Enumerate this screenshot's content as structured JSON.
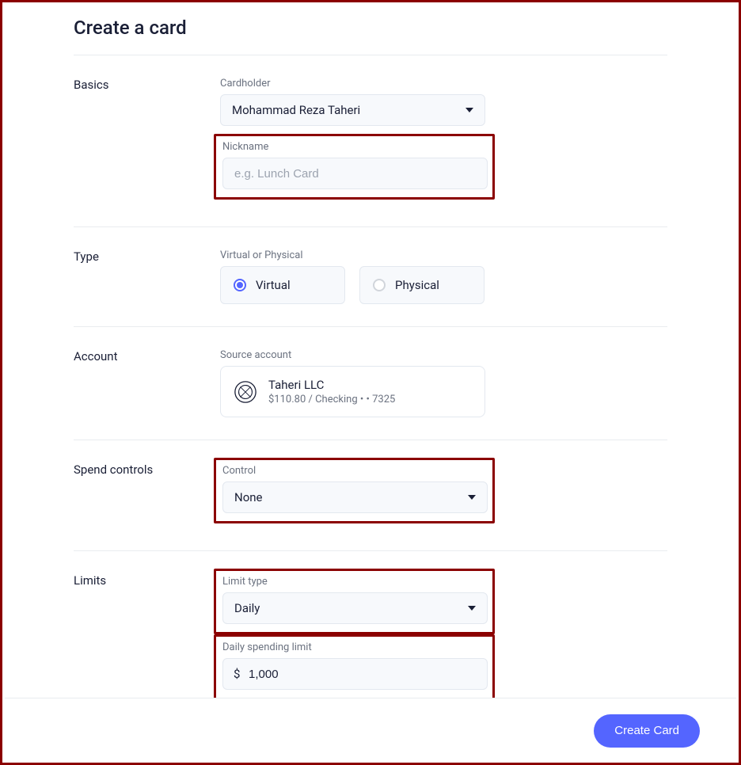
{
  "title": "Create a card",
  "sections": {
    "basics": {
      "label": "Basics",
      "cardholder": {
        "label": "Cardholder",
        "value": "Mohammad Reza Taheri"
      },
      "nickname": {
        "label": "Nickname",
        "placeholder": "e.g. Lunch Card",
        "value": ""
      }
    },
    "type": {
      "label": "Type",
      "group_label": "Virtual or Physical",
      "options": {
        "virtual": "Virtual",
        "physical": "Physical"
      },
      "selected": "virtual"
    },
    "account": {
      "label": "Account",
      "field_label": "Source account",
      "name": "Taheri LLC",
      "balance": "$110.80",
      "type_text": "Checking",
      "last4": "• • 7325"
    },
    "spend_controls": {
      "label": "Spend controls",
      "control": {
        "label": "Control",
        "value": "None"
      }
    },
    "limits": {
      "label": "Limits",
      "limit_type": {
        "label": "Limit type",
        "value": "Daily"
      },
      "daily_limit": {
        "label": "Daily spending limit",
        "currency": "$",
        "value": "1,000"
      }
    }
  },
  "footer": {
    "create_label": "Create Card"
  }
}
